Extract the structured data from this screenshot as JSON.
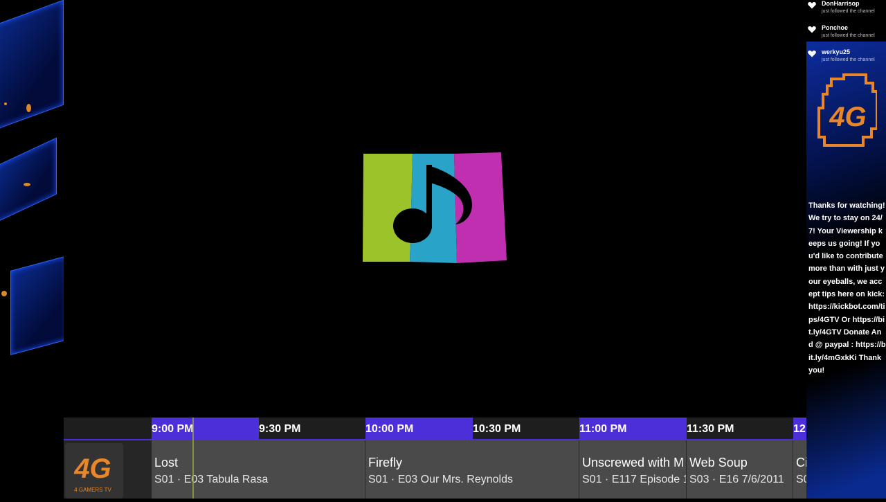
{
  "guide": {
    "time_slots": [
      "9:00 PM",
      "9:30 PM",
      "10:00 PM",
      "10:30 PM",
      "11:00 PM",
      "11:30 PM",
      "12"
    ],
    "channel_logo_text": "4G",
    "channel_logo_subtext": "4 GAMERS TV",
    "programs": [
      {
        "title": "Lost",
        "episode": "S01 · E03 Tabula Rasa"
      },
      {
        "title": "Firefly",
        "episode": "S01 · E03 Our Mrs. Reynolds"
      },
      {
        "title": "Unscrewed with M",
        "episode": "S01 · E117 Episode 1"
      },
      {
        "title": "Web Soup",
        "episode": "S03 · E16 7/6/2011"
      },
      {
        "title": "Ci",
        "episode": "S0"
      }
    ]
  },
  "followers": [
    {
      "name": "DonHarrisop",
      "action": "just followed the channel"
    },
    {
      "name": "Ponchoe",
      "action": "just followed the channel"
    },
    {
      "name": "werkyu25",
      "action": "just followed the channel"
    }
  ],
  "brand_badge_text": "4G",
  "thanks_message": "Thanks for watching! We try to stay on 24/7! Your Viewership keeps us going! If you'd like to contribute more than with just your eyeballs, we accept tips here on kick: https://kickbot.com/tips/4GTV Or https://bit.ly/4GTV Donate And @ paypal : https://bit.ly/4mGxkKi Thank you!",
  "colors": {
    "accent_purple": "#4c2fd8",
    "logo_green": "#9dc32b",
    "logo_blue": "#2aa3c9",
    "logo_pink": "#c02fb0",
    "brand_orange": "#e8862a"
  },
  "icons": [
    "music-note-icon",
    "heart-icon"
  ]
}
